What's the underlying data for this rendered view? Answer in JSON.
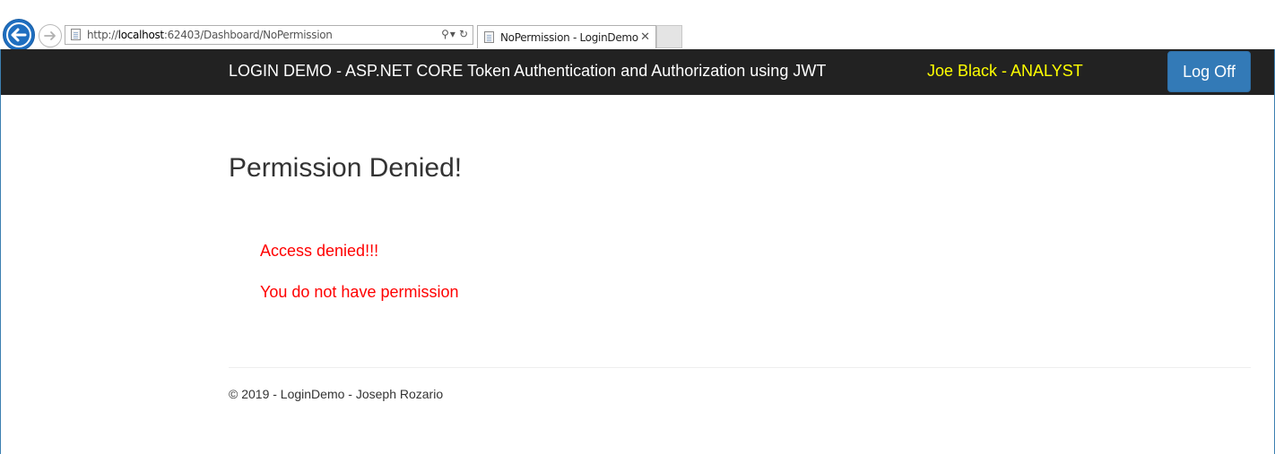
{
  "browser": {
    "url_prefix": "http://",
    "url_host": "localhost",
    "url_rest": ":62403/Dashboard/NoPermission",
    "search_icon": "⚲",
    "dropdown_icon": "▾",
    "refresh_icon": "↻",
    "tab_title": "NoPermission - LoginDemo",
    "tab_close": "✕"
  },
  "navbar": {
    "brand": "LOGIN DEMO - ASP.NET CORE Token Authentication and Authorization using JWT",
    "user_role": "Joe Black - ANALYST",
    "logoff_label": "Log Off"
  },
  "main": {
    "title": "Permission Denied!",
    "message_1": "Access denied!!!",
    "message_2": "You do not have permission"
  },
  "footer": {
    "text": "© 2019 - LoginDemo - Joseph Rozario"
  },
  "colors": {
    "navbar_bg": "#222222",
    "user_role": "#ffff00",
    "button": "#337ab7",
    "error_text": "#ff0000"
  }
}
